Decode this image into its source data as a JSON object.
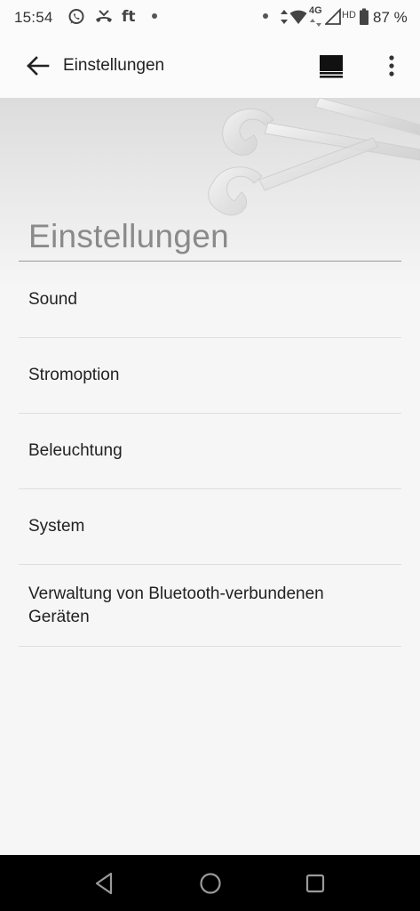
{
  "status_bar": {
    "time": "15:54",
    "notif_text": "ft",
    "network": "4G",
    "hd": "HD",
    "battery": "87 %"
  },
  "app_bar": {
    "title": "Einstellungen"
  },
  "hero": {
    "heading": "Einstellungen"
  },
  "settings": {
    "items": [
      {
        "label": "Sound"
      },
      {
        "label": "Stromoption"
      },
      {
        "label": "Beleuchtung"
      },
      {
        "label": "System"
      },
      {
        "label": "Verwaltung von Bluetooth-verbundenen Geräten"
      }
    ]
  },
  "colors": {
    "background": "#f6f6f6",
    "nav_bar": "#000000",
    "heading": "#8a8a8a"
  }
}
